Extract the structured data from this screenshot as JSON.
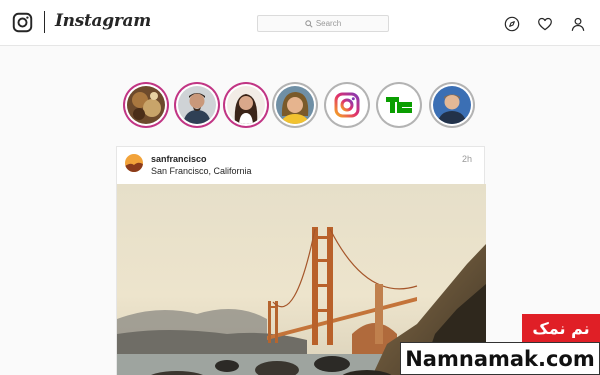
{
  "header": {
    "logo_icon": "instagram-camera-icon",
    "brand": "Instagram",
    "search": {
      "placeholder": "Search",
      "icon": "search-icon"
    },
    "nav_icons": [
      "compass-icon",
      "heart-icon",
      "person-icon"
    ]
  },
  "stories": [
    {
      "name": "story-1",
      "viewed": false
    },
    {
      "name": "story-2",
      "viewed": false
    },
    {
      "name": "story-3",
      "viewed": false
    },
    {
      "name": "story-4",
      "viewed": true
    },
    {
      "name": "story-instagram",
      "viewed": true
    },
    {
      "name": "story-techcrunch",
      "viewed": true
    },
    {
      "name": "story-7",
      "viewed": true
    }
  ],
  "post": {
    "username": "sanfrancisco",
    "location": "San Francisco, California",
    "time": "2h"
  },
  "watermark": {
    "persian": "نم نمک",
    "site": "Namnamak.com"
  },
  "colors": {
    "story_ring": "#c13584",
    "viewed_ring": "#b3b3b3",
    "watermark_red": "#e01f26",
    "techcrunch_green": "#0a9e01"
  }
}
